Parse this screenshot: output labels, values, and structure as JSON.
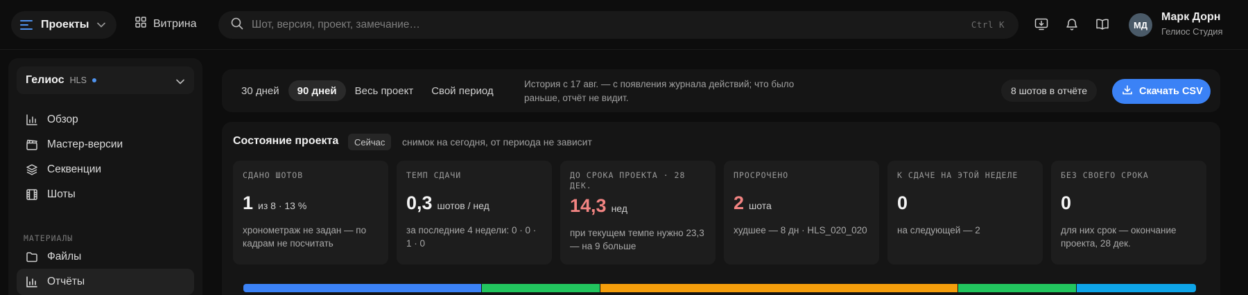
{
  "topbar": {
    "projects_label": "Проекты",
    "vitrina_label": "Витрина",
    "search_placeholder": "Шот, версия, проект, замечание…",
    "search_shortcut": "Ctrl K",
    "icons": [
      "monitor-download-icon",
      "bell-icon",
      "book-icon"
    ],
    "user": {
      "initials": "МД",
      "name": "Марк Дорн",
      "org": "Гелиос Студия"
    }
  },
  "sidebar": {
    "workspace": {
      "name": "Гелиос",
      "code": "HLS"
    },
    "items": [
      {
        "label": "Обзор",
        "icon": "bar-chart-icon"
      },
      {
        "label": "Мастер-версии",
        "icon": "clapperboard-icon"
      },
      {
        "label": "Секвенции",
        "icon": "layers-icon"
      },
      {
        "label": "Шоты",
        "icon": "film-icon"
      }
    ],
    "section_label": "МАТЕРИАЛЫ",
    "materials": [
      {
        "label": "Файлы",
        "icon": "folder-icon"
      },
      {
        "label": "Отчёты",
        "icon": "bar-chart-icon",
        "active": true
      }
    ]
  },
  "period": {
    "options": [
      "30 дней",
      "90 дней",
      "Весь проект",
      "Свой период"
    ],
    "selected": "90 дней",
    "note": "История с 17 авг. — с появления журнала действий; что было раньше, отчёт не видит.",
    "count_label": "8 шотов в отчёте",
    "download_label": "Скачать CSV"
  },
  "status": {
    "title": "Состояние проекта",
    "badge": "Сейчас",
    "note": "снимок на сегодня, от периода не зависит",
    "cards": [
      {
        "label": "СДАНО ШОТОВ",
        "value": "1",
        "unit": "из 8 · 13 %",
        "sub": "хронометраж не задан — по кадрам не посчитать"
      },
      {
        "label": "ТЕМП СДАЧИ",
        "value": "0,3",
        "unit": "шотов / нед",
        "sub": "за последние 4 недели: 0 · 0 · 1 · 0"
      },
      {
        "label": "ДО СРОКА ПРОЕКТА · 28 ДЕК.",
        "value": "14,3",
        "unit": "нед",
        "sub": "при текущем темпе нужно 23,3 — на 9 больше"
      },
      {
        "label": "ПРОСРОЧЕНО",
        "value": "2",
        "unit": "шота",
        "sub": "худшее — 8 дн · HLS_020_020"
      },
      {
        "label": "К СДАЧЕ НА ЭТОЙ НЕДЕЛЕ",
        "value": "0",
        "unit": "",
        "sub": "на следующей — 2"
      },
      {
        "label": "БЕЗ СВОЕГО СРОКА",
        "value": "0",
        "unit": "",
        "sub": "для них срок — окончание проекта, 28 дек."
      }
    ],
    "distribution": [
      {
        "color": "#3b82f6",
        "share": 2
      },
      {
        "color": "#22c55e",
        "share": 1
      },
      {
        "color": "#f59e0b",
        "share": 3
      },
      {
        "color": "#22c55e",
        "share": 1
      },
      {
        "color": "#0ea5e9",
        "share": 1
      }
    ]
  }
}
